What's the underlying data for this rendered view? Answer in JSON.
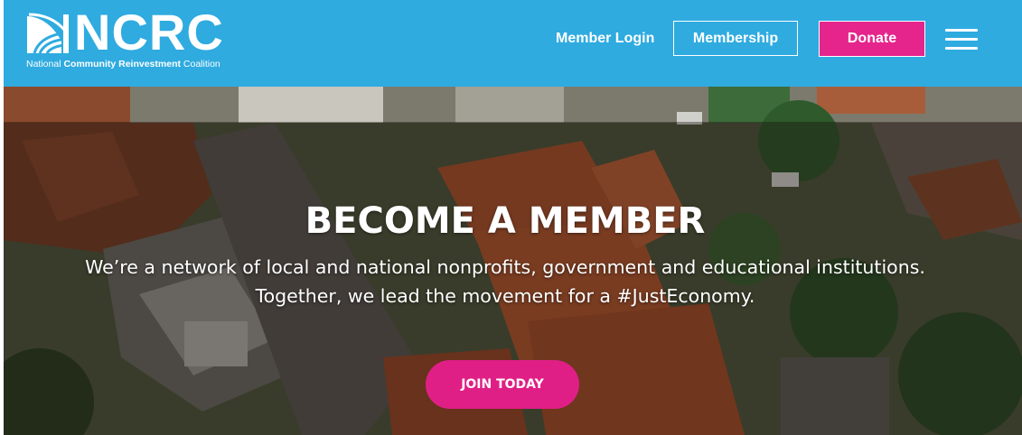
{
  "header": {
    "logo": {
      "wordmark": "NCRC",
      "subtitle_prefix": "National ",
      "subtitle_bold": "Community Reinvestment",
      "subtitle_suffix": " Coalition"
    },
    "nav": {
      "member_login": "Member Login",
      "membership": "Membership",
      "donate": "Donate"
    },
    "menu_icon": "hamburger-menu-icon"
  },
  "hero": {
    "title": "BECOME A MEMBER",
    "line1": "We’re a network of local and national nonprofits, government and educational institutions.",
    "line2": "Together, we lead the movement for a #JustEconomy.",
    "cta": "JOIN TODAY",
    "background": "aerial-neighborhood-rooftops-image"
  },
  "colors": {
    "header_bg": "#2fabe0",
    "accent_pink": "#e5258c",
    "text": "#ffffff"
  }
}
